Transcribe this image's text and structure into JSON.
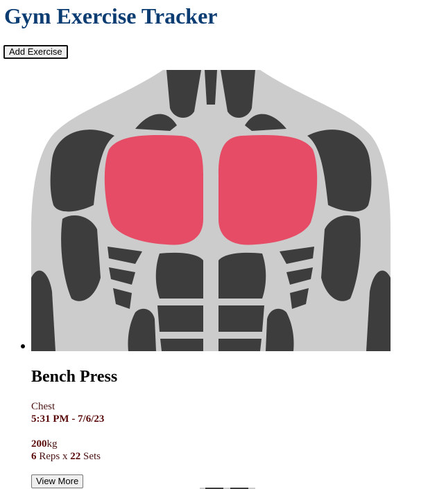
{
  "app": {
    "title": "Gym Exercise Tracker",
    "add_button_label": "Add Exercise"
  },
  "exercises": [
    {
      "image": "chest-muscle-diagram",
      "highlight_color": "#e64c65",
      "name": "Bench Press",
      "muscle_group": "Chest",
      "time": "5:31 PM",
      "date": "7/6/23",
      "datetime_text": "5:31 PM - 7/6/23",
      "weight_value": "200",
      "weight_unit": "kg",
      "reps": "6",
      "reps_label": " Reps x ",
      "sets": "22",
      "sets_label": " Sets",
      "view_more_label": "View More"
    }
  ],
  "colors": {
    "title": "#0b3d73",
    "muscle_dark": "#3d3d3d",
    "body_outline": "#cccccc",
    "highlight": "#e64c65"
  }
}
